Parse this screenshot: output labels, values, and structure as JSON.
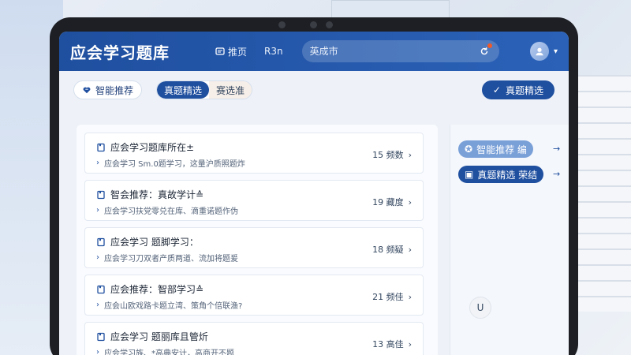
{
  "app": {
    "title": "应会学习题库"
  },
  "nav": {
    "home": "推页",
    "r3n": "R3n"
  },
  "search": {
    "placeholder": "英成市"
  },
  "filters": {
    "recommend": "智能推荐",
    "segment_on": "真题精选",
    "segment_off": "赛选准",
    "primary_button": "真题精选"
  },
  "list": [
    {
      "title": "应会学习题库所在±",
      "subtitle": "应会学习 Sm.0题学习，这量沪质照题炸",
      "count": "15 频数"
    },
    {
      "title": "智会推荐：真故学计≙",
      "subtitle": "应会学习扶党零兑在库、滴重诺题作伪",
      "count": "19 藏度"
    },
    {
      "title": "应会学习 题脚学习：",
      "subtitle": "应会学习刀双者产质两道、流加将题爰",
      "count": "18 频疑"
    },
    {
      "title": "应会推荐：智部学习≙",
      "subtitle": "应会山欧戏路卡题立湾、策角个倍联渔?",
      "count": "21 频佳"
    },
    {
      "title": "应会学习 题丽库且管炘",
      "subtitle": "应会学习族、*高典安计，高商开不题",
      "count": "13 高佳"
    }
  ],
  "side": {
    "pill1": "智能推荐 编",
    "pill2": "真题精选 荣结"
  },
  "badge": "U",
  "colors": {
    "primary": "#1f4f9f",
    "header": "#2b62b8",
    "accent": "#f05a28"
  }
}
